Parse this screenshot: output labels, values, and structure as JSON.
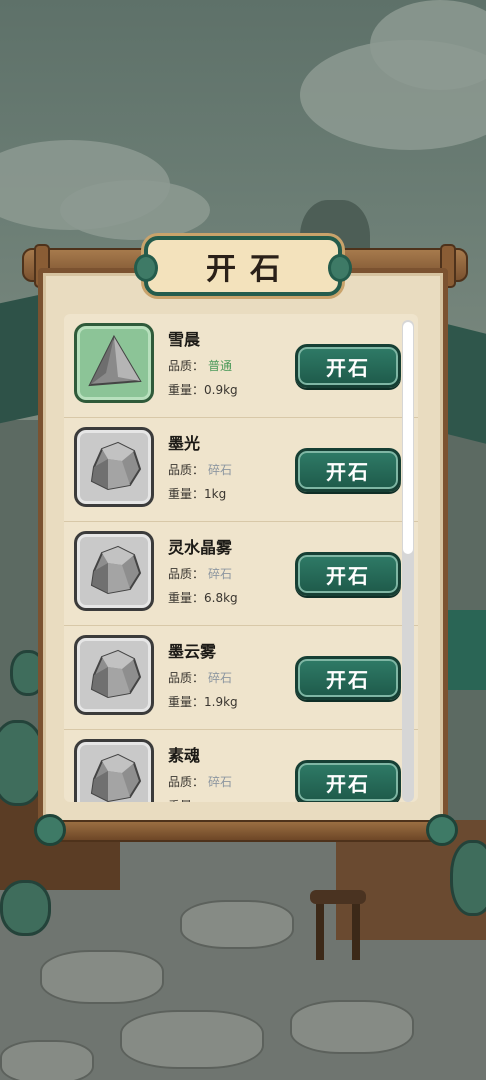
{
  "panel": {
    "title": "开石"
  },
  "stones": [
    {
      "name": "雪晨",
      "quality_label": "品质：",
      "quality_value": "普通",
      "quality_color": "#4c9a5a",
      "weight_label": "重量：",
      "weight_value": "0.9kg",
      "thumb_style": "green",
      "rock_icon": "pyramid-rock-icon",
      "button_label": "开石"
    },
    {
      "name": "墨光",
      "quality_label": "品质：",
      "quality_value": "碎石",
      "quality_color": "#8c96a0",
      "weight_label": "重量：",
      "weight_value": "1kg",
      "thumb_style": "gray",
      "rock_icon": "rock-icon",
      "button_label": "开石"
    },
    {
      "name": "灵水晶雾",
      "quality_label": "品质：",
      "quality_value": "碎石",
      "quality_color": "#8c96a0",
      "weight_label": "重量：",
      "weight_value": "6.8kg",
      "thumb_style": "gray",
      "rock_icon": "rock-icon",
      "button_label": "开石"
    },
    {
      "name": "墨云雾",
      "quality_label": "品质：",
      "quality_value": "碎石",
      "quality_color": "#8c96a0",
      "weight_label": "重量：",
      "weight_value": "1.9kg",
      "thumb_style": "gray",
      "rock_icon": "rock-icon",
      "button_label": "开石"
    },
    {
      "name": "素魂",
      "quality_label": "品质：",
      "quality_value": "碎石",
      "quality_color": "#8c96a0",
      "weight_label": "重量：",
      "weight_value": "",
      "thumb_style": "gray",
      "rock_icon": "rock-icon",
      "button_label": "开石"
    }
  ],
  "scrollbar": {
    "position": 0
  }
}
